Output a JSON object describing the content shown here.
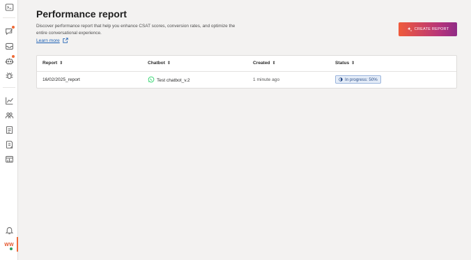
{
  "sidebar": {
    "icons": [
      "terminal-icon",
      "chat-edit-icon",
      "inbox-icon",
      "bot-icon",
      "bug-icon",
      "analytics-icon",
      "users-icon",
      "document-icon",
      "report-icon",
      "dashboard-icon",
      "bell-icon"
    ],
    "avatar_initials": "WW"
  },
  "page": {
    "title": "Performance report",
    "description": "Discover performance report that help you enhance CSAT scores, conversion rates, and optimize the entire conversational experience.",
    "learn_more": "Learn more",
    "create_button": "CREATE REPORT"
  },
  "table": {
    "columns": [
      "Report",
      "Chatbot",
      "Created",
      "Status"
    ],
    "rows": [
      {
        "report": "16/02/2025_report",
        "chatbot": "Test chatbot_v.2",
        "chatbot_channel_icon": "whatsapp-icon",
        "created": "1 minute ago",
        "status": "In progress: 50%",
        "progress": 0.5
      }
    ]
  },
  "colors": {
    "accent_orange": "#ef5b3b",
    "accent_purple": "#8f2c86",
    "link": "#1b5fb3",
    "whatsapp": "#25d366",
    "status_bg": "#e4ecf8"
  }
}
